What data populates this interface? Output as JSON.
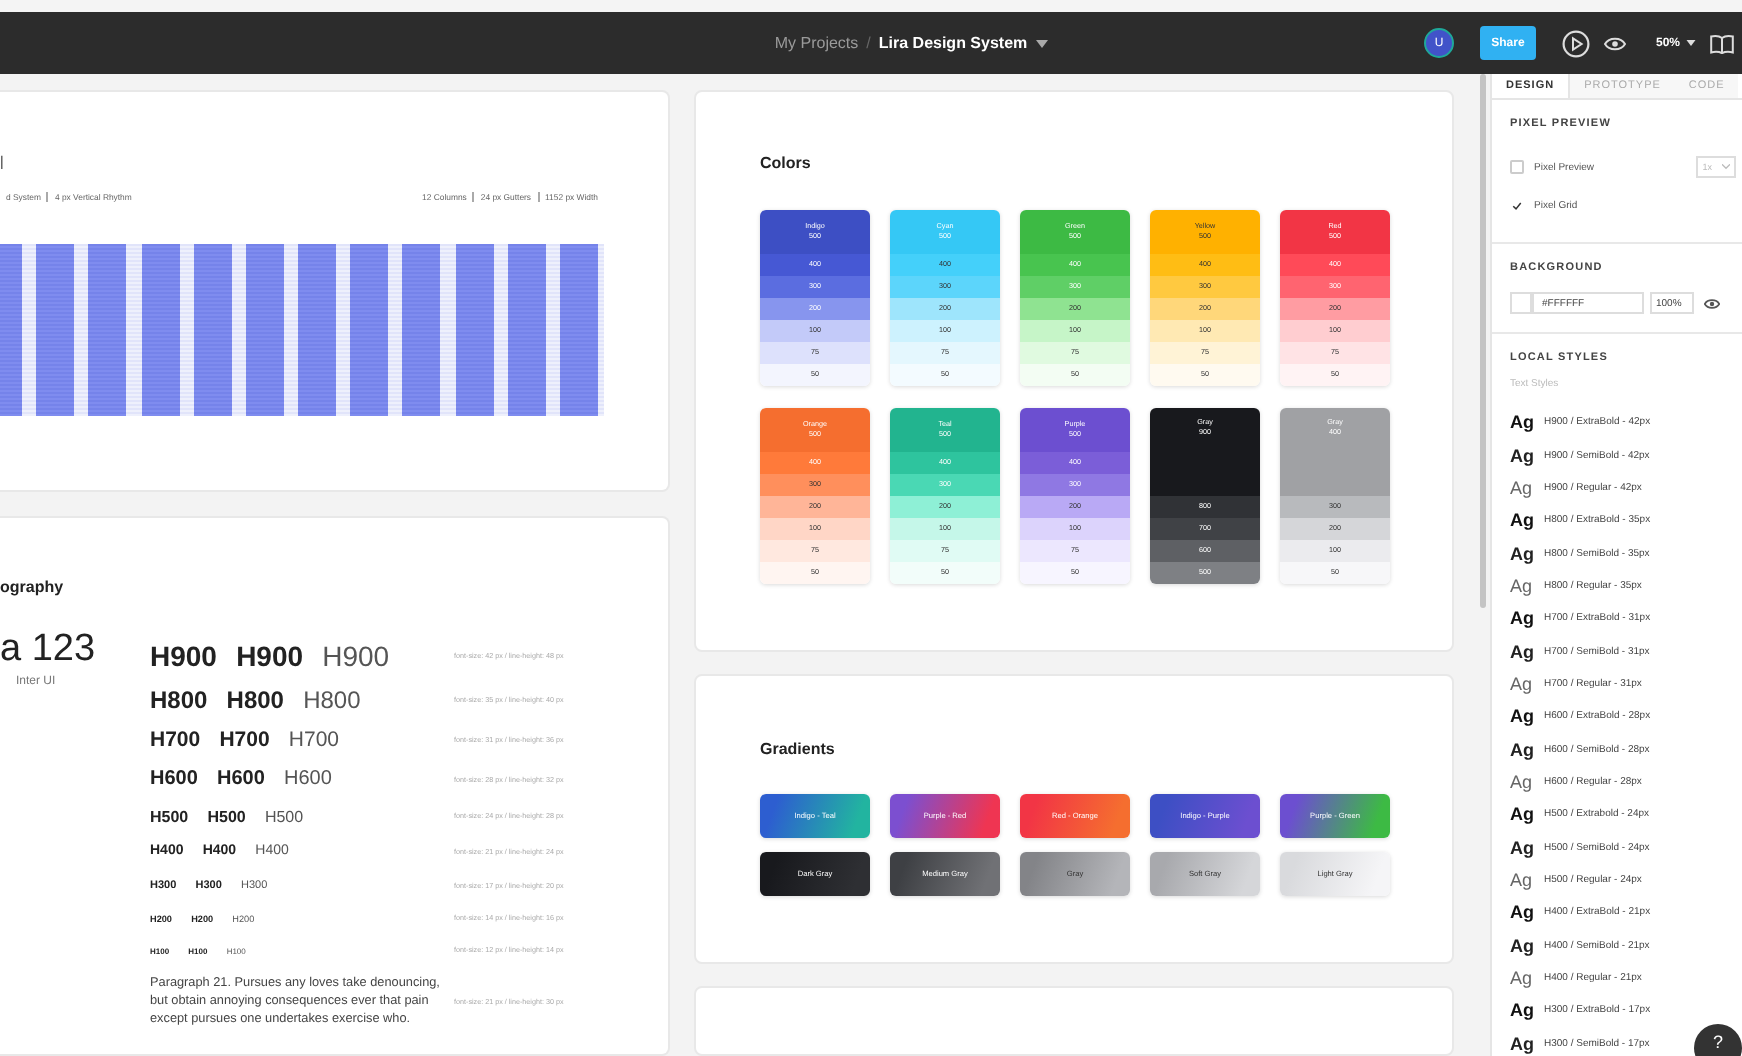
{
  "toolbar": {
    "breadcrumb": "My Projects",
    "separator": "/",
    "title": "Lira Design System",
    "avatar": "U",
    "share": "Share",
    "zoom": "50%"
  },
  "grid_card": {
    "title": "|",
    "specs_left": [
      "d System",
      "4 px Vertical Rhythm"
    ],
    "specs_right": [
      "12 Columns",
      "24 px Gutters",
      "1152 px Width"
    ]
  },
  "typography_card": {
    "title": "ography",
    "sample": "a 123",
    "font_name": "Inter UI",
    "rows": [
      {
        "labels": [
          "H900",
          "H900",
          "H900"
        ],
        "spec": "font-size: 42 px / line-height: 48 px"
      },
      {
        "labels": [
          "H800",
          "H800",
          "H800"
        ],
        "spec": "font-size: 35 px / line-height: 40 px"
      },
      {
        "labels": [
          "H700",
          "H700",
          "H700"
        ],
        "spec": "font-size: 31 px / line-height: 36 px"
      },
      {
        "labels": [
          "H600",
          "H600",
          "H600"
        ],
        "spec": "font-size: 28 px / line-height: 32 px"
      },
      {
        "labels": [
          "H500",
          "H500",
          "H500"
        ],
        "spec": "font-size: 24 px / line-height: 28 px"
      },
      {
        "labels": [
          "H400",
          "H400",
          "H400"
        ],
        "spec": "font-size: 21 px / line-height: 24 px"
      },
      {
        "labels": [
          "H300",
          "H300",
          "H300"
        ],
        "spec": "font-size: 17 px / line-height: 20 px"
      },
      {
        "labels": [
          "H200",
          "H200",
          "H200"
        ],
        "spec": "font-size: 14 px / line-height: 16 px"
      },
      {
        "labels": [
          "H100",
          "H100",
          "H100"
        ],
        "spec": "font-size: 12 px / line-height: 14 px"
      }
    ],
    "paragraph": "Paragraph 21. Pursues any loves take denouncing, but obtain annoying consequences ever that pain except pursues one undertakes exercise who.",
    "paragraph_spec": "font-size: 21 px / line-height: 30 px"
  },
  "colors_card": {
    "title": "Colors",
    "palettes": [
      {
        "name": "Indigo",
        "shades": [
          {
            "label": "500",
            "color": "#3d4fc4"
          },
          {
            "label": "400",
            "color": "#4658d4"
          },
          {
            "label": "300",
            "color": "#5b6de0"
          },
          {
            "label": "200",
            "color": "#8795ee"
          },
          {
            "label": "100",
            "color": "#c3caf9"
          },
          {
            "label": "75",
            "color": "#dde1fc"
          },
          {
            "label": "50",
            "color": "#f3f5fe"
          }
        ]
      },
      {
        "name": "Cyan",
        "shades": [
          {
            "label": "500",
            "color": "#35c8f5"
          },
          {
            "label": "400",
            "color": "#44d0fa"
          },
          {
            "label": "300",
            "color": "#5cd5fb"
          },
          {
            "label": "200",
            "color": "#9ee5fc"
          },
          {
            "label": "100",
            "color": "#cdf2fe"
          },
          {
            "label": "75",
            "color": "#e4f7fe"
          },
          {
            "label": "50",
            "color": "#f3fbff"
          }
        ]
      },
      {
        "name": "Green",
        "shades": [
          {
            "label": "500",
            "color": "#3dba44"
          },
          {
            "label": "400",
            "color": "#48c44f"
          },
          {
            "label": "300",
            "color": "#5fcf66"
          },
          {
            "label": "200",
            "color": "#8fe391"
          },
          {
            "label": "100",
            "color": "#c6f5c8"
          },
          {
            "label": "75",
            "color": "#e0fae0"
          },
          {
            "label": "50",
            "color": "#f3fdf3"
          }
        ]
      },
      {
        "name": "Yellow",
        "shades": [
          {
            "label": "500",
            "color": "#ffb100"
          },
          {
            "label": "400",
            "color": "#ffbd14"
          },
          {
            "label": "300",
            "color": "#ffc940"
          },
          {
            "label": "200",
            "color": "#ffd77a"
          },
          {
            "label": "100",
            "color": "#ffe9b3"
          },
          {
            "label": "75",
            "color": "#fff3d6"
          },
          {
            "label": "50",
            "color": "#fffaf0"
          }
        ]
      },
      {
        "name": "Red",
        "shades": [
          {
            "label": "500",
            "color": "#f23545"
          },
          {
            "label": "400",
            "color": "#ff4a58"
          },
          {
            "label": "300",
            "color": "#ff6470"
          },
          {
            "label": "200",
            "color": "#ff9ca2"
          },
          {
            "label": "100",
            "color": "#ffcdd0"
          },
          {
            "label": "75",
            "color": "#ffe3e5"
          },
          {
            "label": "50",
            "color": "#fff3f4"
          }
        ]
      },
      {
        "name": "Orange",
        "shades": [
          {
            "label": "500",
            "color": "#f56e2f"
          },
          {
            "label": "400",
            "color": "#ff7a3a"
          },
          {
            "label": "300",
            "color": "#ff8f5c"
          },
          {
            "label": "200",
            "color": "#ffb598"
          },
          {
            "label": "100",
            "color": "#ffd6c6"
          },
          {
            "label": "75",
            "color": "#ffe8df"
          },
          {
            "label": "50",
            "color": "#fff5f1"
          }
        ]
      },
      {
        "name": "Teal",
        "shades": [
          {
            "label": "500",
            "color": "#22b48f"
          },
          {
            "label": "400",
            "color": "#2ec49e"
          },
          {
            "label": "300",
            "color": "#4ad8b4"
          },
          {
            "label": "200",
            "color": "#8ef0d6"
          },
          {
            "label": "100",
            "color": "#c5f7e9"
          },
          {
            "label": "75",
            "color": "#e0fbf4"
          },
          {
            "label": "50",
            "color": "#f2fdfa"
          }
        ]
      },
      {
        "name": "Purple",
        "shades": [
          {
            "label": "500",
            "color": "#6c4fd0"
          },
          {
            "label": "400",
            "color": "#7b5ed8"
          },
          {
            "label": "300",
            "color": "#8f78e3"
          },
          {
            "label": "200",
            "color": "#b9a9f5"
          },
          {
            "label": "100",
            "color": "#dcd3fc"
          },
          {
            "label": "75",
            "color": "#ece7fe"
          },
          {
            "label": "50",
            "color": "#f7f5ff"
          }
        ]
      },
      {
        "name": "Gray",
        "shades": [
          {
            "label": "900",
            "color": "#18191d"
          },
          {
            "label": "800",
            "color": "#303236"
          },
          {
            "label": "700",
            "color": "#404246"
          },
          {
            "label": "600",
            "color": "#5e6064"
          },
          {
            "label": "500",
            "color": "#7e8084"
          }
        ]
      },
      {
        "name": "Gray",
        "shades": [
          {
            "label": "400",
            "color": "#a0a1a4"
          },
          {
            "label": "300",
            "color": "#b8babd"
          },
          {
            "label": "200",
            "color": "#d5d6d9"
          },
          {
            "label": "100",
            "color": "#ebebee"
          },
          {
            "label": "50",
            "color": "#f7f7f9"
          }
        ]
      }
    ]
  },
  "gradients_card": {
    "title": "Gradients",
    "gradients": [
      {
        "label": "Indigo - Teal",
        "stops": [
          {
            "color": "#2d5ed0"
          },
          {
            "color": "#22b4a0"
          }
        ]
      },
      {
        "label": "Purple - Red",
        "stops": [
          {
            "color": "#7c4fd0"
          },
          {
            "color": "#ef3552"
          }
        ]
      },
      {
        "label": "Red - Orange",
        "stops": [
          {
            "color": "#f23545"
          },
          {
            "color": "#f56e2f"
          }
        ]
      },
      {
        "label": "Indigo - Purple",
        "stops": [
          {
            "color": "#3d4fc4"
          },
          {
            "color": "#6c4fd0"
          }
        ]
      },
      {
        "label": "Purple - Green",
        "stops": [
          {
            "color": "#6c4fd0"
          },
          {
            "color": "#3dba44"
          }
        ]
      },
      {
        "label": "Dark Gray",
        "stops": [
          {
            "color": "#18191d"
          },
          {
            "color": "#2e2f33"
          }
        ]
      },
      {
        "label": "Medium Gray",
        "stops": [
          {
            "color": "#3e4044"
          },
          {
            "color": "#707175"
          }
        ]
      },
      {
        "label": "Gray",
        "stops": [
          {
            "color": "#838488"
          },
          {
            "color": "#b4b5b9"
          }
        ]
      },
      {
        "label": "Soft Gray",
        "stops": [
          {
            "color": "#a8a9ad"
          },
          {
            "color": "#d5d6d9"
          }
        ]
      },
      {
        "label": "Light Gray",
        "stops": [
          {
            "color": "#d9dadd"
          },
          {
            "color": "#f5f5f7"
          }
        ]
      }
    ]
  },
  "panel": {
    "tabs": [
      {
        "label": "DESIGN",
        "selected": true
      },
      {
        "label": "PROTOTYPE",
        "selected": false
      },
      {
        "label": "CODE",
        "selected": false
      }
    ],
    "pixel_preview": {
      "title": "PIXEL PREVIEW",
      "options": [
        {
          "label": "Pixel Preview",
          "checked": false
        },
        {
          "label": "Pixel Grid",
          "checked": true
        }
      ],
      "scale": "1x"
    },
    "background": {
      "title": "BACKGROUND",
      "color": "#ffffff",
      "hex": "#FFFFFF",
      "opacity": "100%"
    },
    "local_styles": {
      "title": "LOCAL STYLES",
      "subtitle": "Text Styles",
      "styles": [
        {
          "sample": "Ag",
          "label": "H900 / ExtraBold - 42px",
          "kind": "extrabold"
        },
        {
          "sample": "Ag",
          "label": "H900 / SemiBold - 42px",
          "kind": "semibold"
        },
        {
          "sample": "Ag",
          "label": "H900 / Regular - 42px",
          "kind": "regular"
        },
        {
          "sample": "Ag",
          "label": "H800 / ExtraBold - 35px",
          "kind": "extrabold"
        },
        {
          "sample": "Ag",
          "label": "H800 / SemiBold - 35px",
          "kind": "semibold"
        },
        {
          "sample": "Ag",
          "label": "H800 / Regular - 35px",
          "kind": "regular"
        },
        {
          "sample": "Ag",
          "label": "H700 / ExtraBold - 31px",
          "kind": "extrabold"
        },
        {
          "sample": "Ag",
          "label": "H700 / SemiBold - 31px",
          "kind": "semibold"
        },
        {
          "sample": "Ag",
          "label": "H700 / Regular - 31px",
          "kind": "regular"
        },
        {
          "sample": "Ag",
          "label": "H600 / ExtraBold - 28px",
          "kind": "extrabold"
        },
        {
          "sample": "Ag",
          "label": "H600 / SemiBold - 28px",
          "kind": "semibold"
        },
        {
          "sample": "Ag",
          "label": "H600 / Regular - 28px",
          "kind": "regular"
        },
        {
          "sample": "Ag",
          "label": "H500 / Extrabold - 24px",
          "kind": "extrabold"
        },
        {
          "sample": "Ag",
          "label": "H500 / SemiBold - 24px",
          "kind": "semibold"
        },
        {
          "sample": "Ag",
          "label": "H500 / Regular - 24px",
          "kind": "regular"
        },
        {
          "sample": "Ag",
          "label": "H400 / ExtraBold - 21px",
          "kind": "extrabold"
        },
        {
          "sample": "Ag",
          "label": "H400 / SemiBold - 21px",
          "kind": "semibold"
        },
        {
          "sample": "Ag",
          "label": "H400 / Regular - 21px",
          "kind": "regular"
        },
        {
          "sample": "Ag",
          "label": "H300 / ExtraBold - 17px",
          "kind": "extrabold"
        },
        {
          "sample": "Ag",
          "label": "H300 / SemiBold - 17px",
          "kind": "semibold"
        }
      ]
    }
  },
  "help": "?"
}
